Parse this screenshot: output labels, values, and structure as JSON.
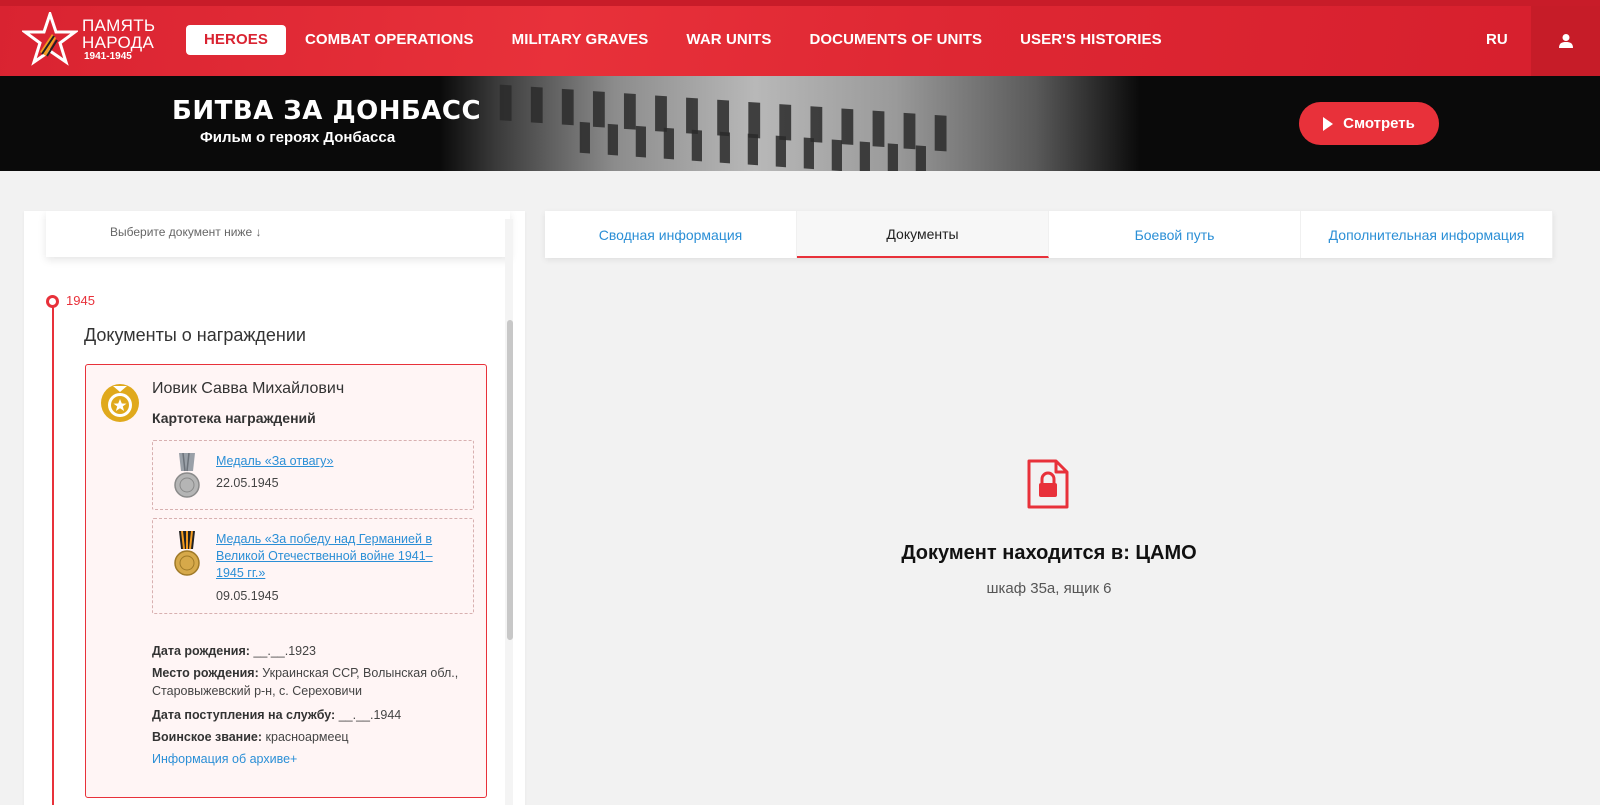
{
  "header": {
    "logo": {
      "line1": "ПАМЯТЬ",
      "line2": "НАРОДА",
      "years": "1941-1945"
    },
    "nav": [
      {
        "label": "HEROES",
        "active": true
      },
      {
        "label": "COMBAT OPERATIONS",
        "active": false
      },
      {
        "label": "MILITARY GRAVES",
        "active": false
      },
      {
        "label": "WAR UNITS",
        "active": false
      },
      {
        "label": "DOCUMENTS OF UNITS",
        "active": false
      },
      {
        "label": "USER'S HISTORIES",
        "active": false
      }
    ],
    "language": "RU",
    "user_icon": "user-icon"
  },
  "banner": {
    "title": "БИТВА ЗА ДОНБАСС",
    "subtitle": "Фильм о героях Донбасса",
    "watch_label": "Смотреть"
  },
  "left_panel": {
    "select_hint": "Выберите документ ниже ↓",
    "year": "1945",
    "section_title": "Документы о награждении",
    "card": {
      "name": "Иовик Савва Михайлович",
      "type": "Картотека награждений",
      "medals": [
        {
          "title": "Медаль «За отвагу»",
          "date": "22.05.1945"
        },
        {
          "title": "Медаль «За победу над Германией в Великой Отечественной войне 1941–1945 гг.»",
          "date": "09.05.1945"
        }
      ],
      "birth_date": {
        "label": "Дата рождения:",
        "value": "__.__.1923"
      },
      "birth_place": {
        "label": "Место рождения:",
        "value": "Украинская ССР, Волынская обл., Старовыжевский р-н, с. Сереховичи"
      },
      "service_date": {
        "label": "Дата поступления на службу:",
        "value": "__.__.1944"
      },
      "rank": {
        "label": "Воинское звание:",
        "value": "красноармеец"
      },
      "archive_link": "Информация об архиве+"
    }
  },
  "tabs": [
    {
      "label": "Сводная информация",
      "active": false
    },
    {
      "label": "Документы",
      "active": true
    },
    {
      "label": "Боевой путь",
      "active": false
    },
    {
      "label": "Дополнительная информация",
      "active": false
    }
  ],
  "document": {
    "title": "Документ находится в: ЦАМО",
    "location": "шкаф 35а, ящик 6",
    "icon": "locked-document-icon"
  },
  "colors": {
    "accent": "#e8313a",
    "link": "#2b8fd6",
    "award_gold": "#e0a91c"
  }
}
